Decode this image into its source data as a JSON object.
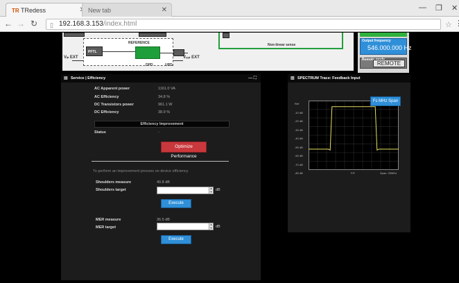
{
  "browser": {
    "tab_active": "TRedess",
    "tab_favicon": "TR",
    "tab_inactive": "New tab",
    "url_host": "192.168.3.153",
    "url_path": "/index.html"
  },
  "diagram": {
    "reference_label": "REFERENCE",
    "nonlinear_label": "Non-linear sense",
    "vin_label": "Vᵢₙ\nEXT",
    "vout_label": "Vₒᵤₜ\nEXT",
    "block_label_1": "PFTL",
    "block_label_2": "UPD",
    "block_label_3": "DPD"
  },
  "right_top": {
    "output_frequency_label": "Output frequency",
    "output_frequency_value": "546.000.000 Hz",
    "remote_mode_label": "Remote mode",
    "remote_button": "REMOTE"
  },
  "efficiency": {
    "title": "Service | Efficiency",
    "rows": [
      {
        "label": "AC Apparent power",
        "value": "1161.0 VA"
      },
      {
        "label": "AC Efficiency",
        "value": "34.8 %"
      },
      {
        "label": "DC Transistors power",
        "value": "961.1 W"
      },
      {
        "label": "DC Efficiency",
        "value": "38.9 %"
      }
    ],
    "improvement_section": "Efficiency Improvement",
    "status_label": "Status",
    "status_value": "-",
    "optimize_button": "Optimize Performance",
    "description": "To perform an improvement process on device efficiency",
    "shoulders_measure_label": "Shoulders measure",
    "shoulders_measure_value": "40.8 dB",
    "shoulders_target_label": "Shoulders target",
    "shoulders_target_value": "",
    "shoulders_unit": "dB",
    "execute_1": "Execute",
    "mer_measure_label": "MER measure",
    "mer_measure_value": "36.5 dB",
    "mer_target_label": "MER target",
    "mer_target_value": "",
    "mer_unit": "dB",
    "execute_2": "Execute"
  },
  "spectrum": {
    "title": "SPECTRUM Trace: Feedback Input",
    "span_button": "Fs MHz Span",
    "y_ticks": [
      "Ref",
      "-10 dB",
      "-20 dB",
      "-30 dB",
      "-40 dB",
      "-50 dB",
      "-60 dB",
      "-70 dB",
      "-80 dB"
    ],
    "x_center_label": "F/F",
    "x_span_label": "Span: 20MHz",
    "trace_color": "#e6e060",
    "chart_data": {
      "type": "line",
      "x": [
        0,
        0.22,
        0.24,
        0.26,
        0.28,
        0.72,
        0.74,
        0.76,
        0.78,
        1
      ],
      "values": [
        -56,
        -56,
        -57,
        -7,
        -7,
        -7,
        -7,
        -57,
        -56,
        -56
      ]
    }
  }
}
